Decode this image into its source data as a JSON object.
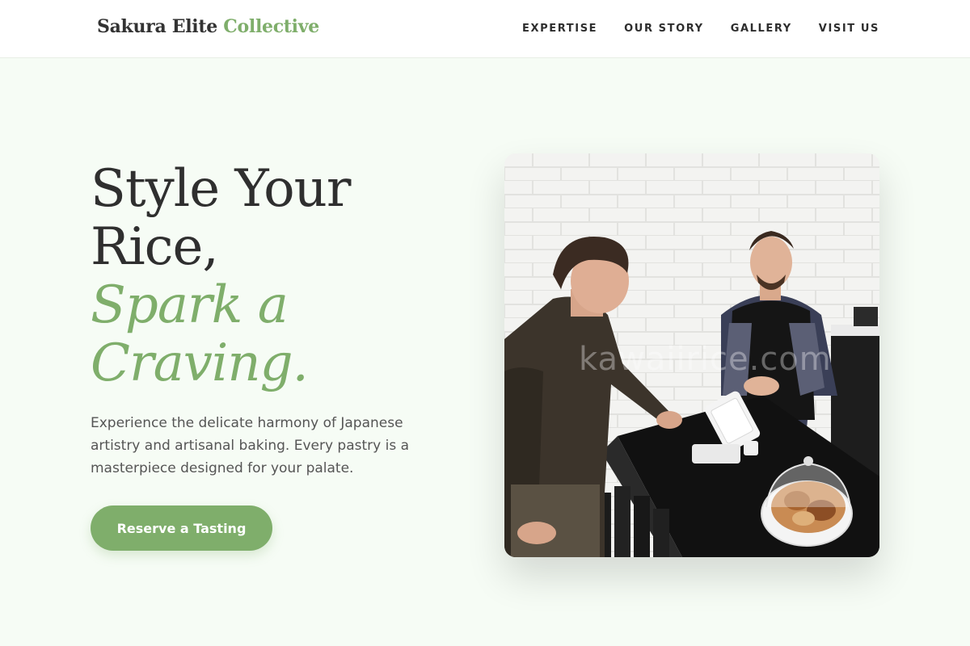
{
  "brand": {
    "name": "Sakura Elite",
    "accent": "Collective"
  },
  "nav": {
    "items": [
      {
        "label": "EXPERTISE"
      },
      {
        "label": "OUR STORY"
      },
      {
        "label": "GALLERY"
      },
      {
        "label": "VISIT US"
      }
    ]
  },
  "hero": {
    "title_line1": "Style Your",
    "title_line2": "Rice,",
    "accent_line1": "Spark a",
    "accent_line2": "Craving.",
    "description": "Experience the delicate harmony of Japanese artistry and artisanal baking. Every pastry is a masterpiece designed for your palate.",
    "cta_label": "Reserve a Tasting"
  },
  "image": {
    "watermark": "kawaiirice.com"
  },
  "colors": {
    "accent": "#7fae6b",
    "background": "#f6fcf5",
    "text_dark": "#2f2f2f",
    "text_body": "#555555",
    "header_bg": "#ffffff"
  }
}
